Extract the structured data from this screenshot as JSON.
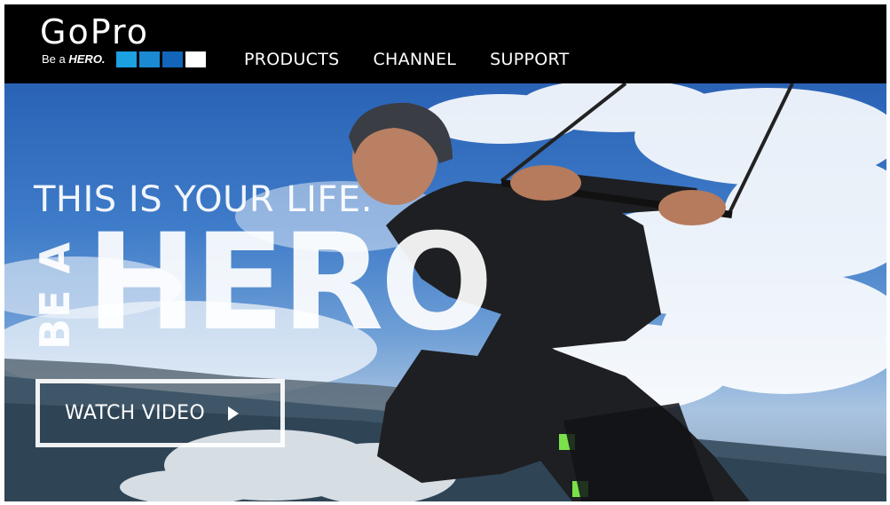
{
  "brand": {
    "name": "GoPro",
    "tagline_prefix": "Be a",
    "tagline_emphasis": "HERO.",
    "square_colors": [
      "#1ba0e2",
      "#1a8ad3",
      "#1265b8",
      "#ffffff"
    ]
  },
  "nav": {
    "items": [
      {
        "label": "PRODUCTS"
      },
      {
        "label": "CHANNEL"
      },
      {
        "label": "SUPPORT"
      }
    ]
  },
  "hero": {
    "headline": "THIS IS YOUR LIFE.",
    "vertical_text": "BE A",
    "big_text": "HERO",
    "cta_label": "WATCH VIDEO",
    "cta_icon": "play-icon"
  },
  "colors": {
    "header_bg": "#000000",
    "text": "#ffffff"
  }
}
